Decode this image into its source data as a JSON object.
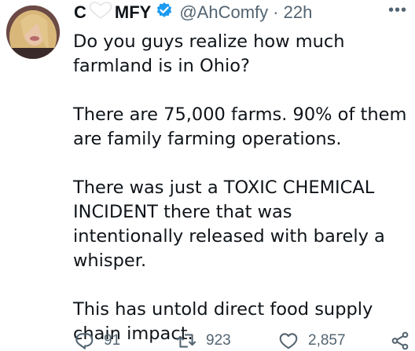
{
  "tweet": {
    "display_name_first": "C",
    "display_name_rest": "MFY",
    "handle": "@AhComfy",
    "time": "· 22h",
    "more_label": "•••",
    "paragraphs": [
      "Do you guys realize how much farmland is in Ohio?",
      "There are 75,000 farms. 90% of them are family farming operations.",
      "There was just a TOXIC CHEMICAL INCIDENT there that was intentionally released with barely a whisper.",
      "This has untold direct food supply chain impact."
    ]
  },
  "actions": {
    "replies": "91",
    "retweets": "923",
    "likes": "2,857"
  },
  "icons": {
    "reply": "reply-icon",
    "retweet": "retweet-icon",
    "like": "heart-icon",
    "share": "share-icon",
    "verified": "verified-badge-icon",
    "name_heart": "heart-outline-icon"
  },
  "colors": {
    "text": "#0f1419",
    "secondary": "#536471",
    "verified": "#1d9bf0"
  }
}
